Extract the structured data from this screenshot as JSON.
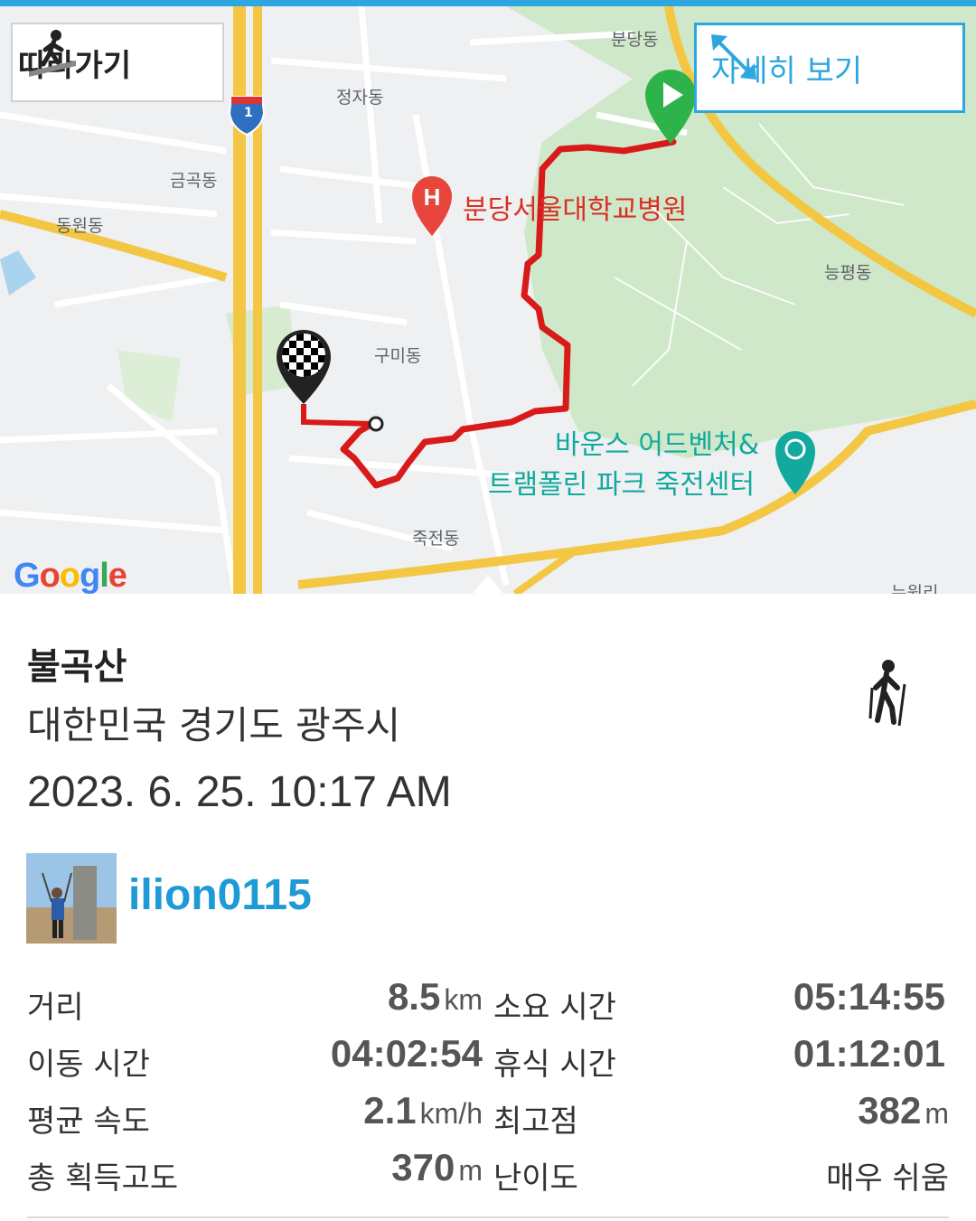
{
  "map": {
    "follow_label": "따라가기",
    "detail_label": "자세히 보기",
    "google_logo": "Google",
    "highway_shield": "1",
    "place_labels": {
      "bundang": "분당동",
      "jeongja": "정자동",
      "geumgok": "금곡동",
      "dongwon": "동원동",
      "neungpyeong": "능평동",
      "gumi": "구미동",
      "jukjeon": "죽전동",
      "nuwol": "누원리"
    },
    "hospital_label": "분당서울대학교병원",
    "park_label_line1": "바운스 어드벤처&",
    "park_label_line2": "트램폴린 파크 죽전센터",
    "route_color": "#d91a1a",
    "start_icon": "play-marker-icon",
    "finish_icon": "checkered-flag-marker-icon"
  },
  "activity": {
    "mountain": "불곡산",
    "location": "대한민국 경기도 광주시",
    "datetime": "2023. 6. 25. 10:17 AM",
    "type_icon": "hiking-icon",
    "username": "ilion0115"
  },
  "stats": {
    "distance": {
      "label": "거리",
      "value": "8.5",
      "unit": "km"
    },
    "total_time": {
      "label": "소요 시간",
      "value": "05:14:55"
    },
    "moving_time": {
      "label": "이동 시간",
      "value": "04:02:54"
    },
    "rest_time": {
      "label": "휴식 시간",
      "value": "01:12:01"
    },
    "avg_speed": {
      "label": "평균 속도",
      "value": "2.1",
      "unit": "km/h"
    },
    "max_altitude": {
      "label": "최고점",
      "value": "382",
      "unit": "m"
    },
    "total_gain": {
      "label": "총 획득고도",
      "value": "370",
      "unit": "m"
    },
    "difficulty": {
      "label": "난이도",
      "value": "매우 쉬움"
    }
  },
  "colors": {
    "accent": "#2ea7e0",
    "username": "#1e9ad6",
    "route": "#d91a1a",
    "start_marker": "#2eb34a"
  }
}
